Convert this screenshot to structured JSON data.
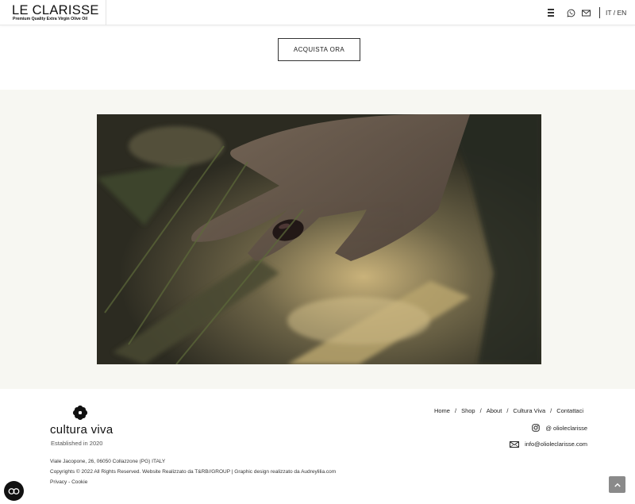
{
  "header": {
    "logo_title": "LE CLARISSE",
    "logo_subtitle": "Premium Quality Extra Virgin Olive Oil",
    "lang_it": "IT",
    "lang_sep": " / ",
    "lang_en": "EN",
    "icons": [
      "menu-icon",
      "whatsapp-icon",
      "mail-icon"
    ]
  },
  "cta": {
    "label": "ACQUISTA ORA"
  },
  "video": {
    "description_icon": "video-player"
  },
  "footer": {
    "brand_title": "cultura viva",
    "brand_subtitle": "Established in 2020",
    "address": "Viale Jacopone, 26, 06050 Collazzone (PG) ITALY",
    "copyright": "Copyrights © 2022 All Rights Reserved. Website Realizzato da T&RB//GROUP | Graphic design realizzato da Audreylilia.com",
    "privacy": "Privacy",
    "legal_sep": " - ",
    "cookie": "Cookie",
    "nav": [
      "Home",
      "Shop",
      "About",
      "Cultura Viva",
      "Contattaci"
    ],
    "nav_sep": "/",
    "instagram": "@ olioleclarisse",
    "email": "info@olioleclarisse.com"
  },
  "colors": {
    "band_bg": "#f7f7f2",
    "text": "#222222",
    "scroll_top_bg": "#8a8a8a"
  }
}
